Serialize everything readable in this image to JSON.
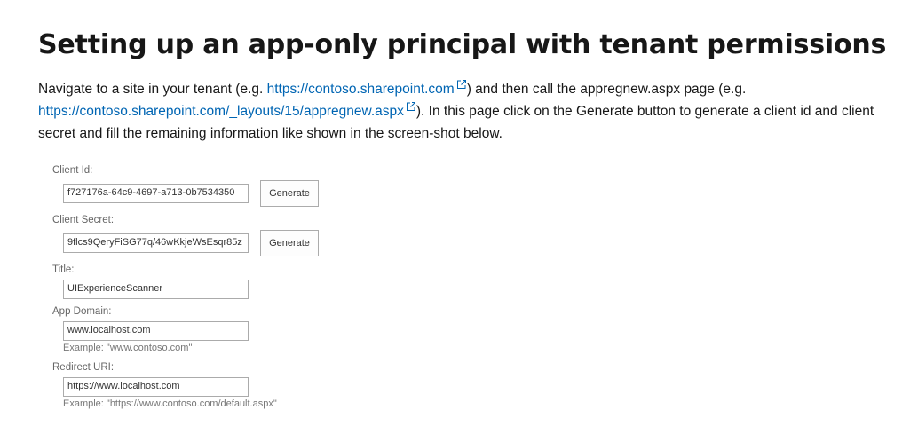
{
  "heading": "Setting up an app-only principal with tenant permissions",
  "paragraph": {
    "part1": "Navigate to a site in your tenant (e.g. ",
    "link1": "https://contoso.sharepoint.com",
    "part2": ") and then call the appregnew.aspx page (e.g. ",
    "link2": "https://contoso.sharepoint.com/_layouts/15/appregnew.aspx",
    "part3": "). In this page click on the Generate button to generate a client id and client secret and fill the remaining information like shown in the screen-shot below."
  },
  "form": {
    "client_id": {
      "label": "Client Id:",
      "value": "f727176a-64c9-4697-a713-0b7534350",
      "button": "Generate"
    },
    "client_secret": {
      "label": "Client Secret:",
      "value": "9flcs9QeryFiSG77q/46wKkjeWsEsqr85z",
      "button": "Generate"
    },
    "title": {
      "label": "Title:",
      "value": "UIExperienceScanner"
    },
    "app_domain": {
      "label": "App Domain:",
      "value": "www.localhost.com",
      "example": "Example: \"www.contoso.com\""
    },
    "redirect_uri": {
      "label": "Redirect URI:",
      "value": "https://www.localhost.com",
      "example": "Example: \"https://www.contoso.com/default.aspx\""
    }
  },
  "icons": {
    "external_link": "external-link-icon"
  },
  "colors": {
    "link": "#0065b3",
    "text": "#171717"
  }
}
